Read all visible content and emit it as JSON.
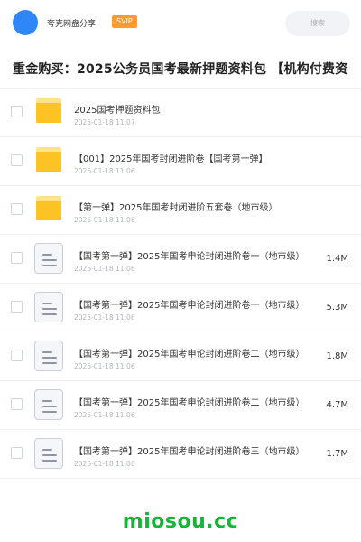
{
  "header": {
    "brand": "夸克网盘分享",
    "badge": "SVIP",
    "search_placeholder": "搜索",
    "avatar_color": "#2f86f6",
    "badge_color": "#ff9a2e"
  },
  "title": "重金购买：2025公务员国考最新押题资料包 【机构付费资",
  "files": [
    {
      "type": "folder",
      "name": "2025国考押题资料包",
      "date": "2025-01-18 11:07",
      "size": ""
    },
    {
      "type": "folder",
      "name": "【001】2025年国考封闭进阶卷【国考第一弹】",
      "date": "2025-01-18 11:06",
      "size": ""
    },
    {
      "type": "folder",
      "name": "【第一弹】2025年国考封闭进阶五套卷（地市级）",
      "date": "2025-01-18 11:06",
      "size": ""
    },
    {
      "type": "doc",
      "name": "【国考第一弹】2025年国考申论封闭进阶卷一（地市级）",
      "date": "2025-01-18 11:06",
      "size": "1.4M"
    },
    {
      "type": "doc",
      "name": "【国考第一弹】2025年国考申论封闭进阶卷一（地市级）",
      "date": "2025-01-18 11:06",
      "size": "5.3M"
    },
    {
      "type": "doc",
      "name": "【国考第一弹】2025年国考申论封闭进阶卷二（地市级）",
      "date": "2025-01-18 11:06",
      "size": "1.8M"
    },
    {
      "type": "doc",
      "name": "【国考第一弹】2025年国考申论封闭进阶卷二（地市级）",
      "date": "2025-01-18 11:06",
      "size": "4.7M"
    },
    {
      "type": "doc",
      "name": "【国考第一弹】2025年国考申论封闭进阶卷三（地市级）",
      "date": "2025-01-18 11:06",
      "size": "1.7M"
    }
  ],
  "watermark": "miosou.cc",
  "watermark_color": "#16b53a"
}
